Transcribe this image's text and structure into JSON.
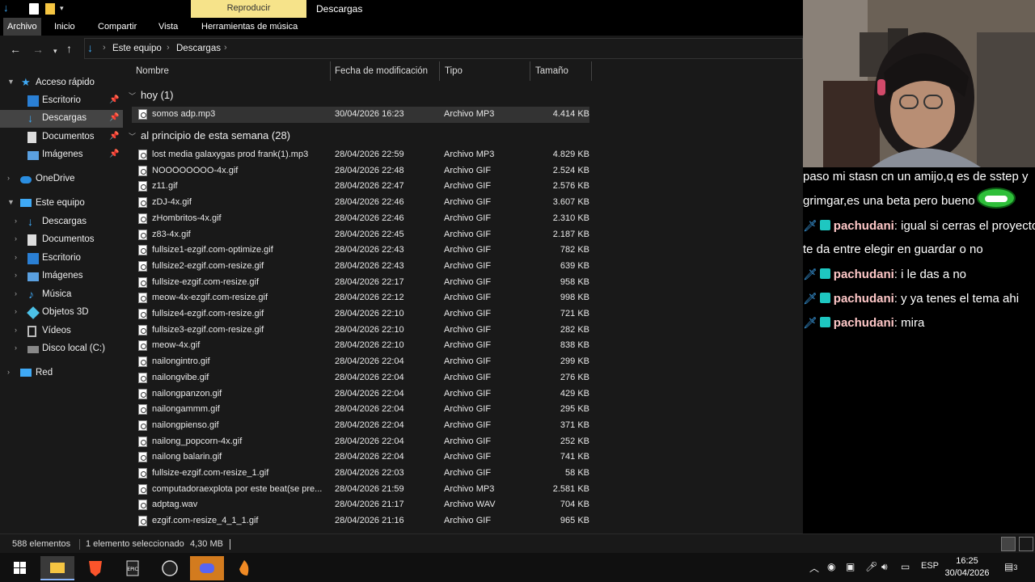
{
  "window": {
    "title": "Descargas",
    "context_tab": "Reproducir"
  },
  "ribbon": {
    "tabs": [
      "Archivo",
      "Inicio",
      "Compartir",
      "Vista",
      "Herramientas de música"
    ]
  },
  "address": {
    "crumbs": [
      "Este equipo",
      "Descargas"
    ]
  },
  "columns": {
    "name": "Nombre",
    "date": "Fecha de modificación",
    "type": "Tipo",
    "size": "Tamaño"
  },
  "nav": {
    "quick_access": "Acceso rápido",
    "quick_items": [
      "Escritorio",
      "Descargas",
      "Documentos",
      "Imágenes"
    ],
    "onedrive": "OneDrive",
    "this_pc": "Este equipo",
    "pc_items": [
      "Descargas",
      "Documentos",
      "Escritorio",
      "Imágenes",
      "Música",
      "Objetos 3D",
      "Vídeos",
      "Disco local (C:)"
    ],
    "network": "Red"
  },
  "groups": {
    "today": "hoy (1)",
    "this_week": "al principio de esta semana (28)"
  },
  "today_files": [
    {
      "name": "somos adp.mp3",
      "date": "30/04/2026 16:23",
      "type": "Archivo MP3",
      "size": "4.414 KB"
    }
  ],
  "week_files": [
    {
      "name": "lost media galaxygas prod frank(1).mp3",
      "date": "28/04/2026 22:59",
      "type": "Archivo MP3",
      "size": "4.829 KB"
    },
    {
      "name": "NOOOOOOOO-4x.gif",
      "date": "28/04/2026 22:48",
      "type": "Archivo GIF",
      "size": "2.524 KB"
    },
    {
      "name": "z11.gif",
      "date": "28/04/2026 22:47",
      "type": "Archivo GIF",
      "size": "2.576 KB"
    },
    {
      "name": "zDJ-4x.gif",
      "date": "28/04/2026 22:46",
      "type": "Archivo GIF",
      "size": "3.607 KB"
    },
    {
      "name": "zHombritos-4x.gif",
      "date": "28/04/2026 22:46",
      "type": "Archivo GIF",
      "size": "2.310 KB"
    },
    {
      "name": "z83-4x.gif",
      "date": "28/04/2026 22:45",
      "type": "Archivo GIF",
      "size": "2.187 KB"
    },
    {
      "name": "fullsize1-ezgif.com-optimize.gif",
      "date": "28/04/2026 22:43",
      "type": "Archivo GIF",
      "size": "782 KB"
    },
    {
      "name": "fullsize2-ezgif.com-resize.gif",
      "date": "28/04/2026 22:43",
      "type": "Archivo GIF",
      "size": "639 KB"
    },
    {
      "name": "fullsize-ezgif.com-resize.gif",
      "date": "28/04/2026 22:17",
      "type": "Archivo GIF",
      "size": "958 KB"
    },
    {
      "name": "meow-4x-ezgif.com-resize.gif",
      "date": "28/04/2026 22:12",
      "type": "Archivo GIF",
      "size": "998 KB"
    },
    {
      "name": "fullsize4-ezgif.com-resize.gif",
      "date": "28/04/2026 22:10",
      "type": "Archivo GIF",
      "size": "721 KB"
    },
    {
      "name": "fullsize3-ezgif.com-resize.gif",
      "date": "28/04/2026 22:10",
      "type": "Archivo GIF",
      "size": "282 KB"
    },
    {
      "name": "meow-4x.gif",
      "date": "28/04/2026 22:10",
      "type": "Archivo GIF",
      "size": "838 KB"
    },
    {
      "name": "nailongintro.gif",
      "date": "28/04/2026 22:04",
      "type": "Archivo GIF",
      "size": "299 KB"
    },
    {
      "name": "nailongvibe.gif",
      "date": "28/04/2026 22:04",
      "type": "Archivo GIF",
      "size": "276 KB"
    },
    {
      "name": "nailongpanzon.gif",
      "date": "28/04/2026 22:04",
      "type": "Archivo GIF",
      "size": "429 KB"
    },
    {
      "name": "nailongammm.gif",
      "date": "28/04/2026 22:04",
      "type": "Archivo GIF",
      "size": "295 KB"
    },
    {
      "name": "nailongpienso.gif",
      "date": "28/04/2026 22:04",
      "type": "Archivo GIF",
      "size": "371 KB"
    },
    {
      "name": "nailong_popcorn-4x.gif",
      "date": "28/04/2026 22:04",
      "type": "Archivo GIF",
      "size": "252 KB"
    },
    {
      "name": "nailong balarin.gif",
      "date": "28/04/2026 22:04",
      "type": "Archivo GIF",
      "size": "741 KB"
    },
    {
      "name": "fullsize-ezgif.com-resize_1.gif",
      "date": "28/04/2026 22:03",
      "type": "Archivo GIF",
      "size": "58 KB"
    },
    {
      "name": "computadoraexplota por este beat(se pre...",
      "date": "28/04/2026 21:59",
      "type": "Archivo MP3",
      "size": "2.581 KB"
    },
    {
      "name": "adptag.wav",
      "date": "28/04/2026 21:17",
      "type": "Archivo WAV",
      "size": "704 KB"
    },
    {
      "name": "ezgif.com-resize_4_1_1.gif",
      "date": "28/04/2026 21:16",
      "type": "Archivo GIF",
      "size": "965 KB"
    }
  ],
  "status": {
    "count": "588 elementos",
    "selected": "1 elemento seleccionado",
    "size": "4,30 MB"
  },
  "chat": [
    {
      "user": "",
      "text": "paso mi stasn cn un amijo,q es de sstep y"
    },
    {
      "user": "",
      "text": "grimgar,es una beta pero bueno"
    },
    {
      "user": "pachudani",
      "text": ": igual si cerras el proyecto"
    },
    {
      "user": "",
      "text": "te da entre elegir en guardar o no"
    },
    {
      "user": "pachudani",
      "text": ": i le das a no"
    },
    {
      "user": "pachudani",
      "text": ": y ya tenes el tema ahi"
    },
    {
      "user": "pachudani",
      "text": ": mira"
    }
  ],
  "taskbar": {
    "lang": "ESP",
    "time": "16:25",
    "date": "30/04/2026",
    "notif_count": "3"
  },
  "colors": {
    "ctx_tab": "#f6e38a",
    "accent": "#0a78d7",
    "badge": "#1ec7c1",
    "username": "#ffc8c8"
  }
}
